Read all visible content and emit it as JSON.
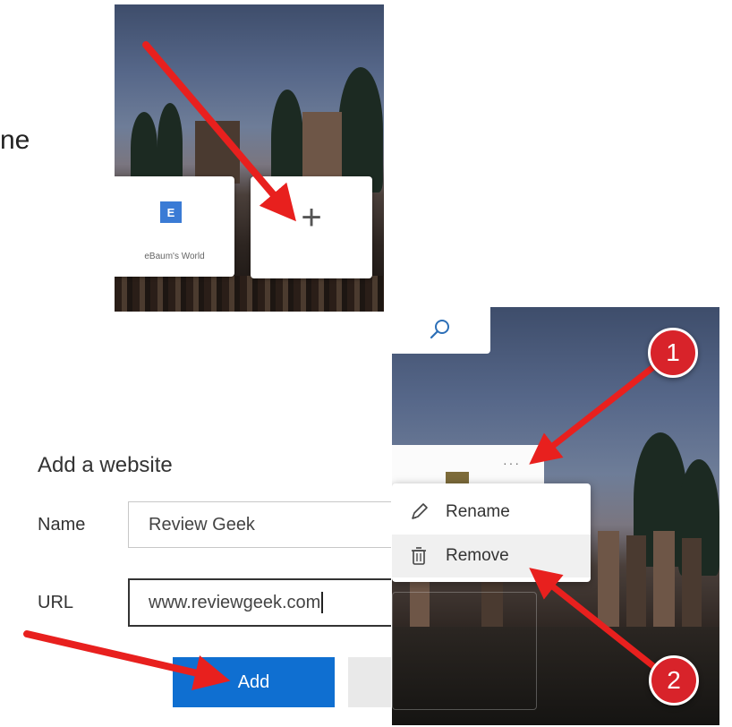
{
  "fragment_text": "ne",
  "new_tab": {
    "tiles": [
      {
        "label": "eBaum's World",
        "logo_letter": "E"
      }
    ],
    "add_tile_glyph": "+"
  },
  "context_menu": {
    "more_glyph": "···",
    "items": [
      {
        "label": "Rename",
        "icon": "pencil-icon"
      },
      {
        "label": "Remove",
        "icon": "trash-icon"
      }
    ]
  },
  "dialog": {
    "title": "Add a website",
    "name_label": "Name",
    "name_value": "Review Geek",
    "url_label": "URL",
    "url_value": "www.reviewgeek.com",
    "add_label": "Add"
  },
  "callouts": {
    "step_1": "1",
    "step_2": "2"
  },
  "colors": {
    "arrow": "#e8201e",
    "badge": "#d8232a",
    "add_button": "#0f6fd1"
  }
}
